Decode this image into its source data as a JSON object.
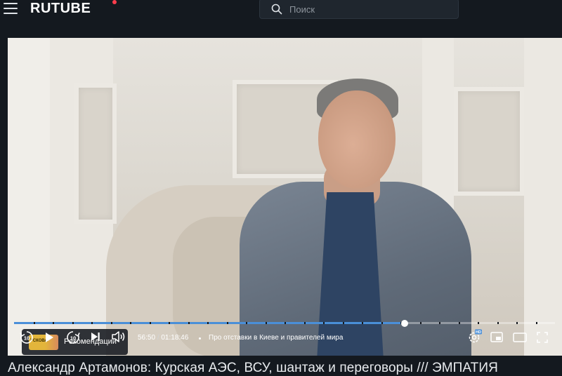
{
  "header": {
    "logo_text": "RUTUBE",
    "search": {
      "placeholder": "Поиск"
    }
  },
  "player": {
    "recommendations_label": "Рекомендации",
    "recommendations_thumb_text": "УСКОВА",
    "progress": {
      "played_fraction": 0.722,
      "current_time": "56:50",
      "separator": "/",
      "duration": "01:18:46"
    },
    "chapter_title": "Про отставки в Киеве и правителей мира",
    "controls": {
      "rewind": "rewind-10-icon",
      "play": "play-icon",
      "forward": "forward-10-icon",
      "next": "next-icon",
      "volume": "volume-icon",
      "quality": "quality-settings-icon",
      "quality_badge": "HD",
      "pip": "picture-in-picture-icon",
      "theater": "theater-mode-icon",
      "fullscreen": "fullscreen-icon"
    }
  },
  "video_title": "Александр Артамонов: Курская АЭС, ВСУ, шантаж и переговоры /// ЭМПАТИЯ",
  "colors": {
    "accent": "#4a8fd8",
    "logo_dot": "#ff3d4c",
    "background": "#14191f"
  }
}
